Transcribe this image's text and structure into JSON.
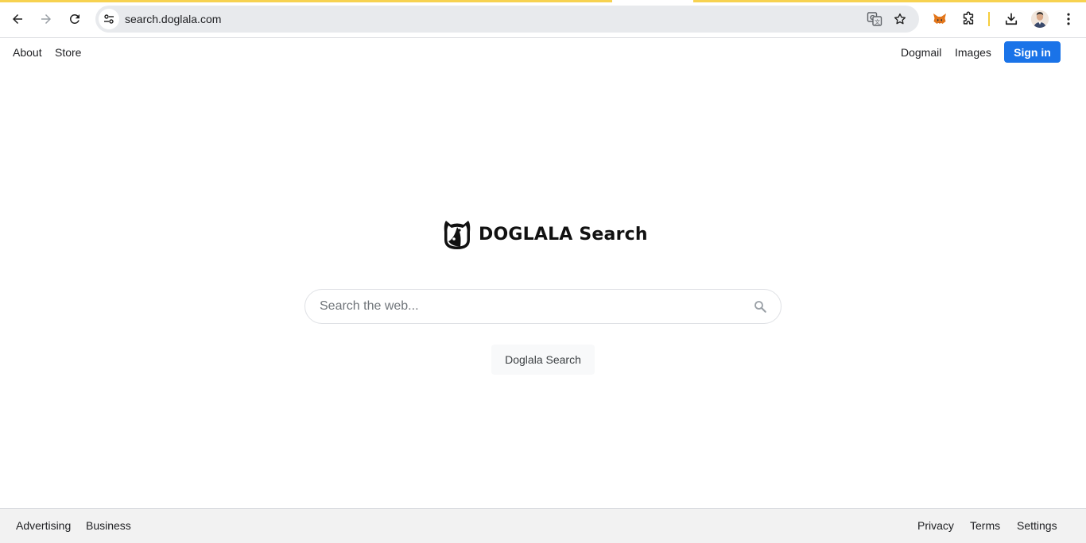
{
  "browser": {
    "url": "search.doglala.com",
    "accent_color": "#f6cd3c"
  },
  "header": {
    "left_links": [
      "About",
      "Store"
    ],
    "right_links": [
      "Dogmail",
      "Images"
    ],
    "sign_in_label": "Sign in"
  },
  "brand": {
    "name": "DOGLALA Search"
  },
  "search": {
    "placeholder": "Search the web...",
    "value": "",
    "button_label": "Doglala Search"
  },
  "footer": {
    "left_links": [
      "Advertising",
      "Business"
    ],
    "right_links": [
      "Privacy",
      "Terms",
      "Settings"
    ]
  },
  "colors": {
    "sign_in_bg": "#1a73e8",
    "footer_bg": "#f2f2f2"
  }
}
